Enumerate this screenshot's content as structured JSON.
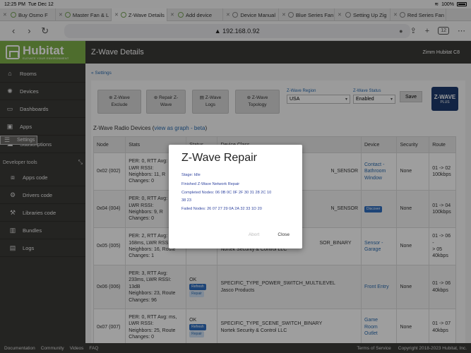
{
  "status_bar": {
    "time": "12:25 PM",
    "date": "Tue Dec 12",
    "wifi": "wifi",
    "battery": "100%"
  },
  "browser": {
    "tabs": [
      {
        "title": "Buy Osmo F"
      },
      {
        "title": "Master Fan & L"
      },
      {
        "title": "Z-Wave Details",
        "active": true
      },
      {
        "title": "Add device"
      },
      {
        "title": "Device Manual"
      },
      {
        "title": "Blue Series Fan"
      },
      {
        "title": "Setting Up Zig"
      },
      {
        "title": "Red Series Fan"
      }
    ],
    "url": "192.168.0.92",
    "tab_count": "12",
    "aa": "AA"
  },
  "sidebar": {
    "logo_word": "Hubitat",
    "logo_tag": "ELEVATE YOUR ENVIRONMENT",
    "items": [
      {
        "label": "Rooms",
        "icon": "home-icon"
      },
      {
        "label": "Devices",
        "icon": "bulb-icon"
      },
      {
        "label": "Dashboards",
        "icon": "dashboard-icon"
      },
      {
        "label": "Apps",
        "icon": "apps-icon"
      },
      {
        "label": "Settings",
        "icon": "settings-icon",
        "selected": true
      },
      {
        "label": "Subscriptions",
        "icon": "subscriptions-icon"
      }
    ],
    "developer_tools": "Developer tools",
    "dev_items": [
      {
        "label": "Apps code"
      },
      {
        "label": "Drivers code"
      },
      {
        "label": "Libraries code"
      },
      {
        "label": "Bundles"
      },
      {
        "label": "Logs"
      }
    ]
  },
  "header": {
    "title": "Z-Wave Details",
    "hub": "Zimm Hubitat C8"
  },
  "breadcrumb": "« Settings",
  "toolbar": {
    "exclude": [
      "Z-Wave",
      "Exclude"
    ],
    "repair": [
      "Repair Z-",
      "Wave"
    ],
    "logs": [
      "Z-Wave",
      "Logs"
    ],
    "topology": [
      "Z-Wave",
      "Topology"
    ],
    "region_label": "Z-Wave Region",
    "region_value": "USA",
    "status_label": "Z-Wave Status",
    "status_value": "Enabled",
    "save": "Save",
    "zw_logo_top": "Z-WAVE",
    "zw_logo_bottom": "PLUS"
  },
  "radio": {
    "title": "Z-Wave Radio Devices (",
    "link": "view as graph - beta",
    "close": ")"
  },
  "table": {
    "headers": [
      "Node",
      "Stats",
      "Status",
      "Device Class",
      "Device",
      "Security",
      "Route"
    ],
    "rows": [
      {
        "node": "0x02 (002)",
        "stats": [
          "PER: 0, RTT Avg:",
          "LWR RSSI:",
          "Neighbors: 11, R",
          "Changes: 0"
        ],
        "status": "",
        "class": [
          "N_SENSOR"
        ],
        "device": [
          "Contact -",
          "Bathroom",
          "Window"
        ],
        "security": "None",
        "route": [
          "01 -> 02",
          "100kbps"
        ]
      },
      {
        "node": "0x04 (004)",
        "stats": [
          "PER: 0, RTT Avg:",
          "LWR RSSI:",
          "Neighbors: 9, R",
          "Changes: 0"
        ],
        "status": "",
        "class": [
          "N_SENSOR"
        ],
        "device_badge": "Discover",
        "security": "None",
        "route": [
          "01 -> 04",
          "100kbps"
        ]
      },
      {
        "node": "0x05 (005)",
        "stats": [
          "PER: 2, RTT Avg:",
          "168ms, LWR RSSI:",
          "Neighbors: 16, Route",
          "Changes: 1"
        ],
        "status": "",
        "class": [
          "SOR_BINARY",
          "Nortek Security & Control LLC"
        ],
        "device": [
          "Sensor -",
          "Garage"
        ],
        "security": "None",
        "route": [
          "01 -> 06 -",
          "> 05",
          "40kbps"
        ]
      },
      {
        "node": "0x06 (006)",
        "stats": [
          "PER: 3, RTT Avg:",
          "233ms, LWR RSSI:",
          "13dB",
          "Neighbors: 23, Route",
          "Changes: 96"
        ],
        "status": "OK",
        "class": [
          "SPECIFIC_TYPE_POWER_SWITCH_MULTILEVEL",
          "Jasco Products"
        ],
        "device": [
          "Front Entry"
        ],
        "security": "None",
        "route": [
          "01 -> 06",
          "40kbps"
        ]
      },
      {
        "node": "0x07 (007)",
        "stats": [
          "PER: 0, RTT Avg: ms,",
          "LWR RSSI:",
          "Neighbors: 25, Route",
          "Changes: 0"
        ],
        "status": "OK",
        "class": [
          "SPECIFIC_TYPE_SCENE_SWITCH_BINARY",
          "Nortek Security & Control LLC"
        ],
        "device": [
          "Game",
          "Room",
          "Outlet"
        ],
        "security": "None",
        "route": [
          "01 -> 07",
          "40kbps"
        ]
      }
    ],
    "refresh": "Refresh",
    "repair": "Repair"
  },
  "modal": {
    "title": "Z-Wave Repair",
    "stage": "Stage: Idle",
    "finished": "Finished Z-Wave Network Repair",
    "completed": "Completed Nodes: 06 0B 0C 0F 2F 30 31 28 2C 10",
    "completed2": " 38 23",
    "failed": "Failed Nodes: 26 07 27 29 0A 2A 32 33 1D 20",
    "abort": "Abort",
    "close": "Close"
  },
  "footer": {
    "links": [
      "Documentation",
      "Community",
      "Videos",
      "FAQ"
    ],
    "terms": "Terms of Service",
    "copyright": "Copyright 2018-2023 Hubitat, Inc."
  }
}
